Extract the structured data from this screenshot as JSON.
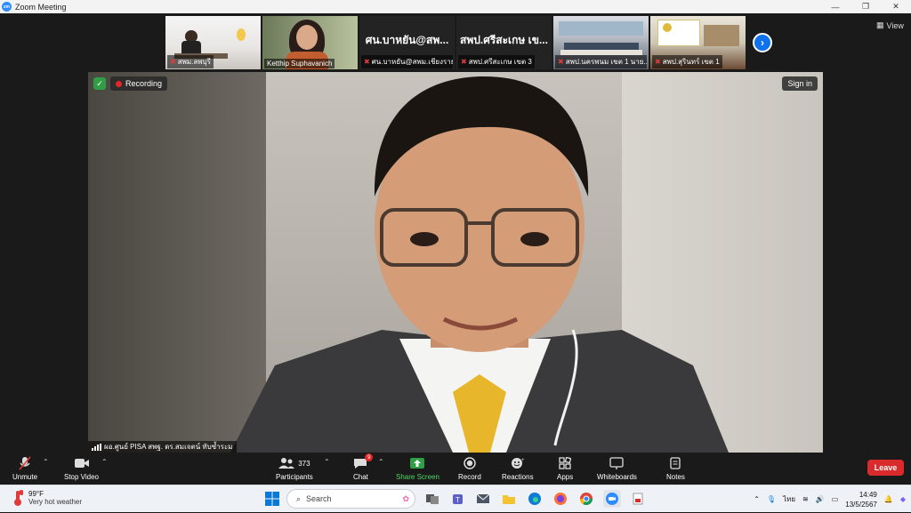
{
  "window": {
    "title": "Zoom Meeting",
    "minimize": "—",
    "restore": "❐",
    "close": "✕"
  },
  "gallery": {
    "view_label": "View",
    "thumbnails": [
      {
        "label": "สพม.ลพบุรี",
        "big": ""
      },
      {
        "label": "Ketthip Suphavanich",
        "big": ""
      },
      {
        "label": "ศน.บาหยัน@สพม.เชียงราย",
        "big": "ศน.บาหยัน@สพ..."
      },
      {
        "label": "สพป.ศรีสะเกษ เขต 3",
        "big": "สพป.ศรีสะเกษ เข..."
      },
      {
        "label": "สพป.นครพนม เขต 1 นาย...",
        "big": ""
      },
      {
        "label": "สพป.สุรินทร์ เขต 1",
        "big": ""
      }
    ]
  },
  "main": {
    "recording_label": "Recording",
    "signin_label": "Sign in",
    "speaker": "ผอ.ศูนย์ PISA สพฐ. ดร.สมเจตน์ ทับซ้ำระม"
  },
  "toolbar": {
    "unmute": "Unmute",
    "stop_video": "Stop Video",
    "participants": "Participants",
    "participants_count": "373",
    "chat": "Chat",
    "chat_badge": "9",
    "share_screen": "Share Screen",
    "record": "Record",
    "reactions": "Reactions",
    "apps": "Apps",
    "whiteboards": "Whiteboards",
    "notes": "Notes",
    "leave": "Leave"
  },
  "taskbar": {
    "weather_temp": "99°F",
    "weather_desc": "Very hot weather",
    "search_placeholder": "Search",
    "language": "ไทย",
    "time": "14:49",
    "date": "13/5/2567"
  },
  "colors": {
    "accent": "#0e72ed",
    "leave": "#d92b2b",
    "share": "#2f9e44",
    "recording": "#e02828"
  }
}
